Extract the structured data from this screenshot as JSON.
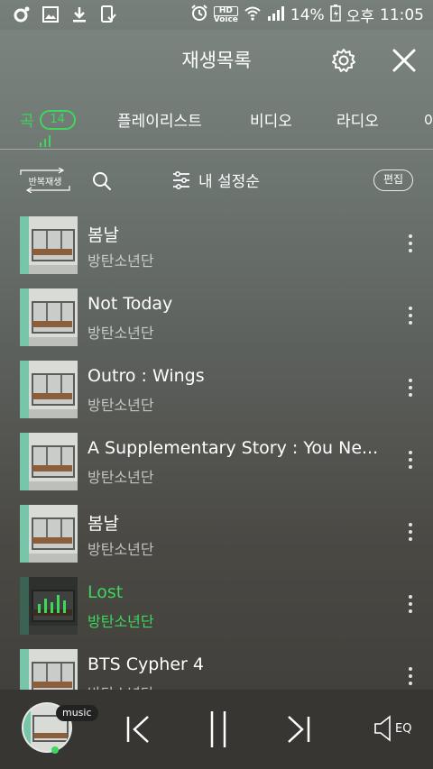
{
  "statusbar": {
    "battery": "14%",
    "ampm": "오후",
    "time": "11:05",
    "hd_label": "HD",
    "voice_label": "Voice"
  },
  "header": {
    "title": "재생목록"
  },
  "tabs": [
    {
      "label": "곡",
      "count": "14",
      "active": true
    },
    {
      "label": "플레이리스트"
    },
    {
      "label": "비디오"
    },
    {
      "label": "라디오"
    },
    {
      "label": "아"
    }
  ],
  "toolbar": {
    "repeat_label": "반복재생",
    "sort_label": "내 설정순",
    "edit_label": "편집"
  },
  "songs": [
    {
      "title": "봄날",
      "artist": "방탄소년단"
    },
    {
      "title": "Not Today",
      "artist": "방탄소년단"
    },
    {
      "title": "Outro : Wings",
      "artist": "방탄소년단"
    },
    {
      "title": "A Supplementary Story : You Ne...",
      "artist": "방탄소년단"
    },
    {
      "title": "봄날",
      "artist": "방탄소년단"
    },
    {
      "title": "Lost",
      "artist": "방탄소년단",
      "playing": true
    },
    {
      "title": "BTS Cypher 4",
      "artist": "방탄소년단"
    }
  ],
  "player": {
    "tag": "music",
    "eq_label": "EQ"
  },
  "colors": {
    "accent": "#3ed65c"
  }
}
